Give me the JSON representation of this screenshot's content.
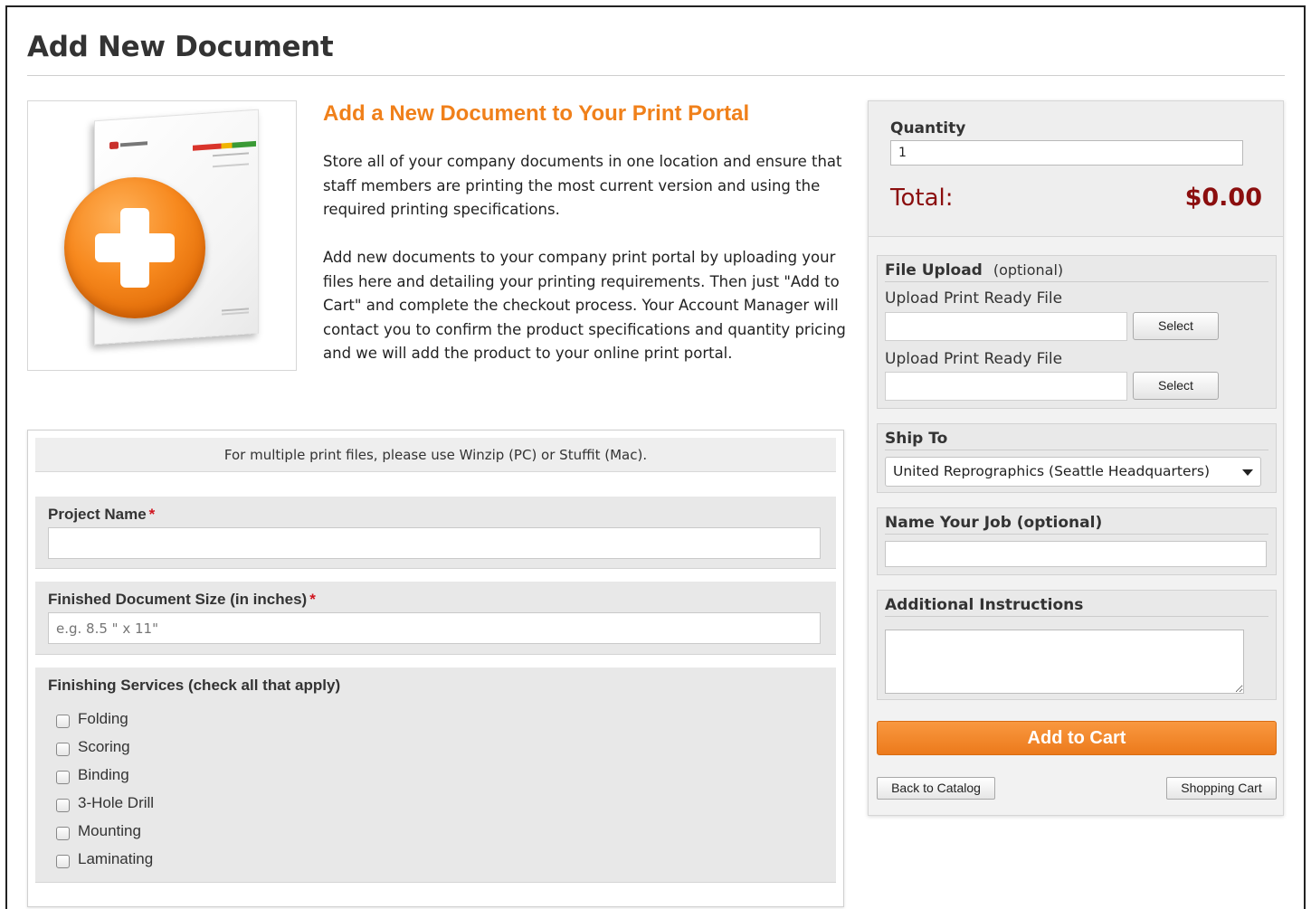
{
  "page": {
    "title": "Add New Document"
  },
  "intro": {
    "heading": "Add a New Document to Your Print Portal",
    "paragraph1": "Store all of your company documents in one location and ensure that staff members are printing the most current version and using the required printing specifications.",
    "paragraph2": "Add new documents to your company print portal by uploading your files here and detailing your printing requirements. Then just \"Add to Cart\" and complete the checkout process. Your Account Manager will contact you to confirm the product specifications and quantity pricing and we will add the product to your online print portal."
  },
  "form": {
    "notice": "For multiple print files, please use Winzip (PC) or Stuffit (Mac).",
    "required_marker": "*",
    "project_name": {
      "label": "Project Name",
      "value": ""
    },
    "document_size": {
      "label": "Finished Document Size (in inches)",
      "placeholder": "e.g. 8.5 \" x 11\""
    },
    "finishing": {
      "label": "Finishing Services (check all that apply)",
      "options": [
        {
          "label": "Folding",
          "checked": false
        },
        {
          "label": "Scoring",
          "checked": false
        },
        {
          "label": "Binding",
          "checked": false
        },
        {
          "label": "3-Hole Drill",
          "checked": false
        },
        {
          "label": "Mounting",
          "checked": false
        },
        {
          "label": "Laminating",
          "checked": false
        }
      ]
    }
  },
  "sidebar": {
    "quantity_label": "Quantity",
    "quantity_value": "1",
    "total_label": "Total:",
    "total_value": "$0.00",
    "file_upload": {
      "title": "File Upload",
      "optional": "(optional)",
      "uploads": [
        {
          "label": "Upload Print Ready File",
          "button": "Select"
        },
        {
          "label": "Upload Print Ready File",
          "button": "Select"
        }
      ]
    },
    "ship_to": {
      "title": "Ship To",
      "selected": "United Reprographics (Seattle Headquarters)"
    },
    "job_name": {
      "title": "Name Your Job (optional)",
      "value": ""
    },
    "instructions": {
      "title": "Additional Instructions",
      "value": ""
    },
    "add_to_cart": "Add to Cart",
    "back_to_catalog": "Back to Catalog",
    "shopping_cart": "Shopping Cart"
  },
  "colors": {
    "accent_orange": "#f0801a",
    "total_red": "#8b0e0e",
    "required_red": "#d0141e"
  }
}
